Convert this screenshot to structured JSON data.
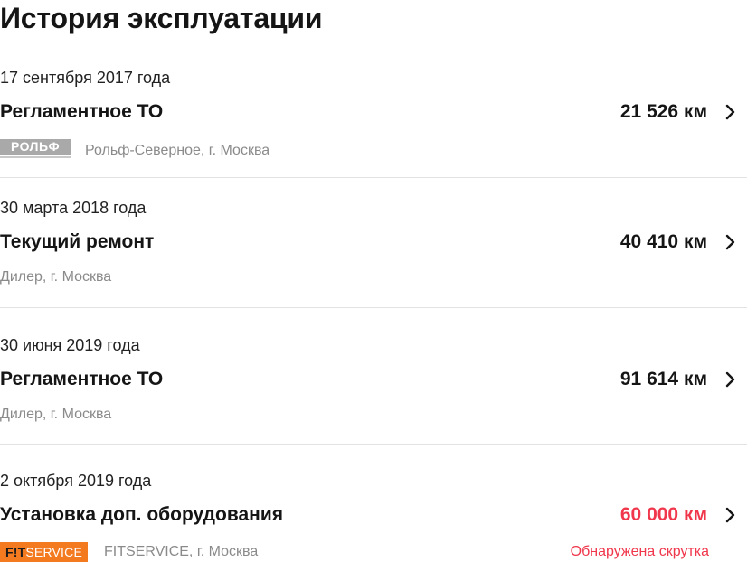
{
  "page_title": "История эксплуатации",
  "entries": [
    {
      "date": "17 сентября 2017 года",
      "service": "Регламентное ТО",
      "mileage": "21 526 км",
      "dealer_logo": "РОЛЬФ",
      "dealer": "Рольф-Северное, г. Москва"
    },
    {
      "date": "30 марта 2018 года",
      "service": "Текущий ремонт",
      "mileage": "40 410 км",
      "dealer": "Дилер, г. Москва"
    },
    {
      "date": "30 июня 2019 года",
      "service": "Регламентное ТО",
      "mileage": "91 614 км",
      "dealer": "Дилер, г. Москва"
    },
    {
      "date": "2 октября 2019 года",
      "service": "Установка доп. оборудования",
      "mileage": "60 000 км",
      "dealer_logo_prefix": "F!T",
      "dealer_logo_suffix": "SERVICE",
      "dealer": "FITSERVICE, г. Москва",
      "warning": "Обнаружена скрутка"
    }
  ],
  "colors": {
    "alert": "#f0374c",
    "muted_text": "#8a8a8a",
    "fitservice_brand": "#f47a20",
    "rolf_logo": "#a9a9a9"
  },
  "icons": {
    "row_action": "chevron-right-icon"
  }
}
